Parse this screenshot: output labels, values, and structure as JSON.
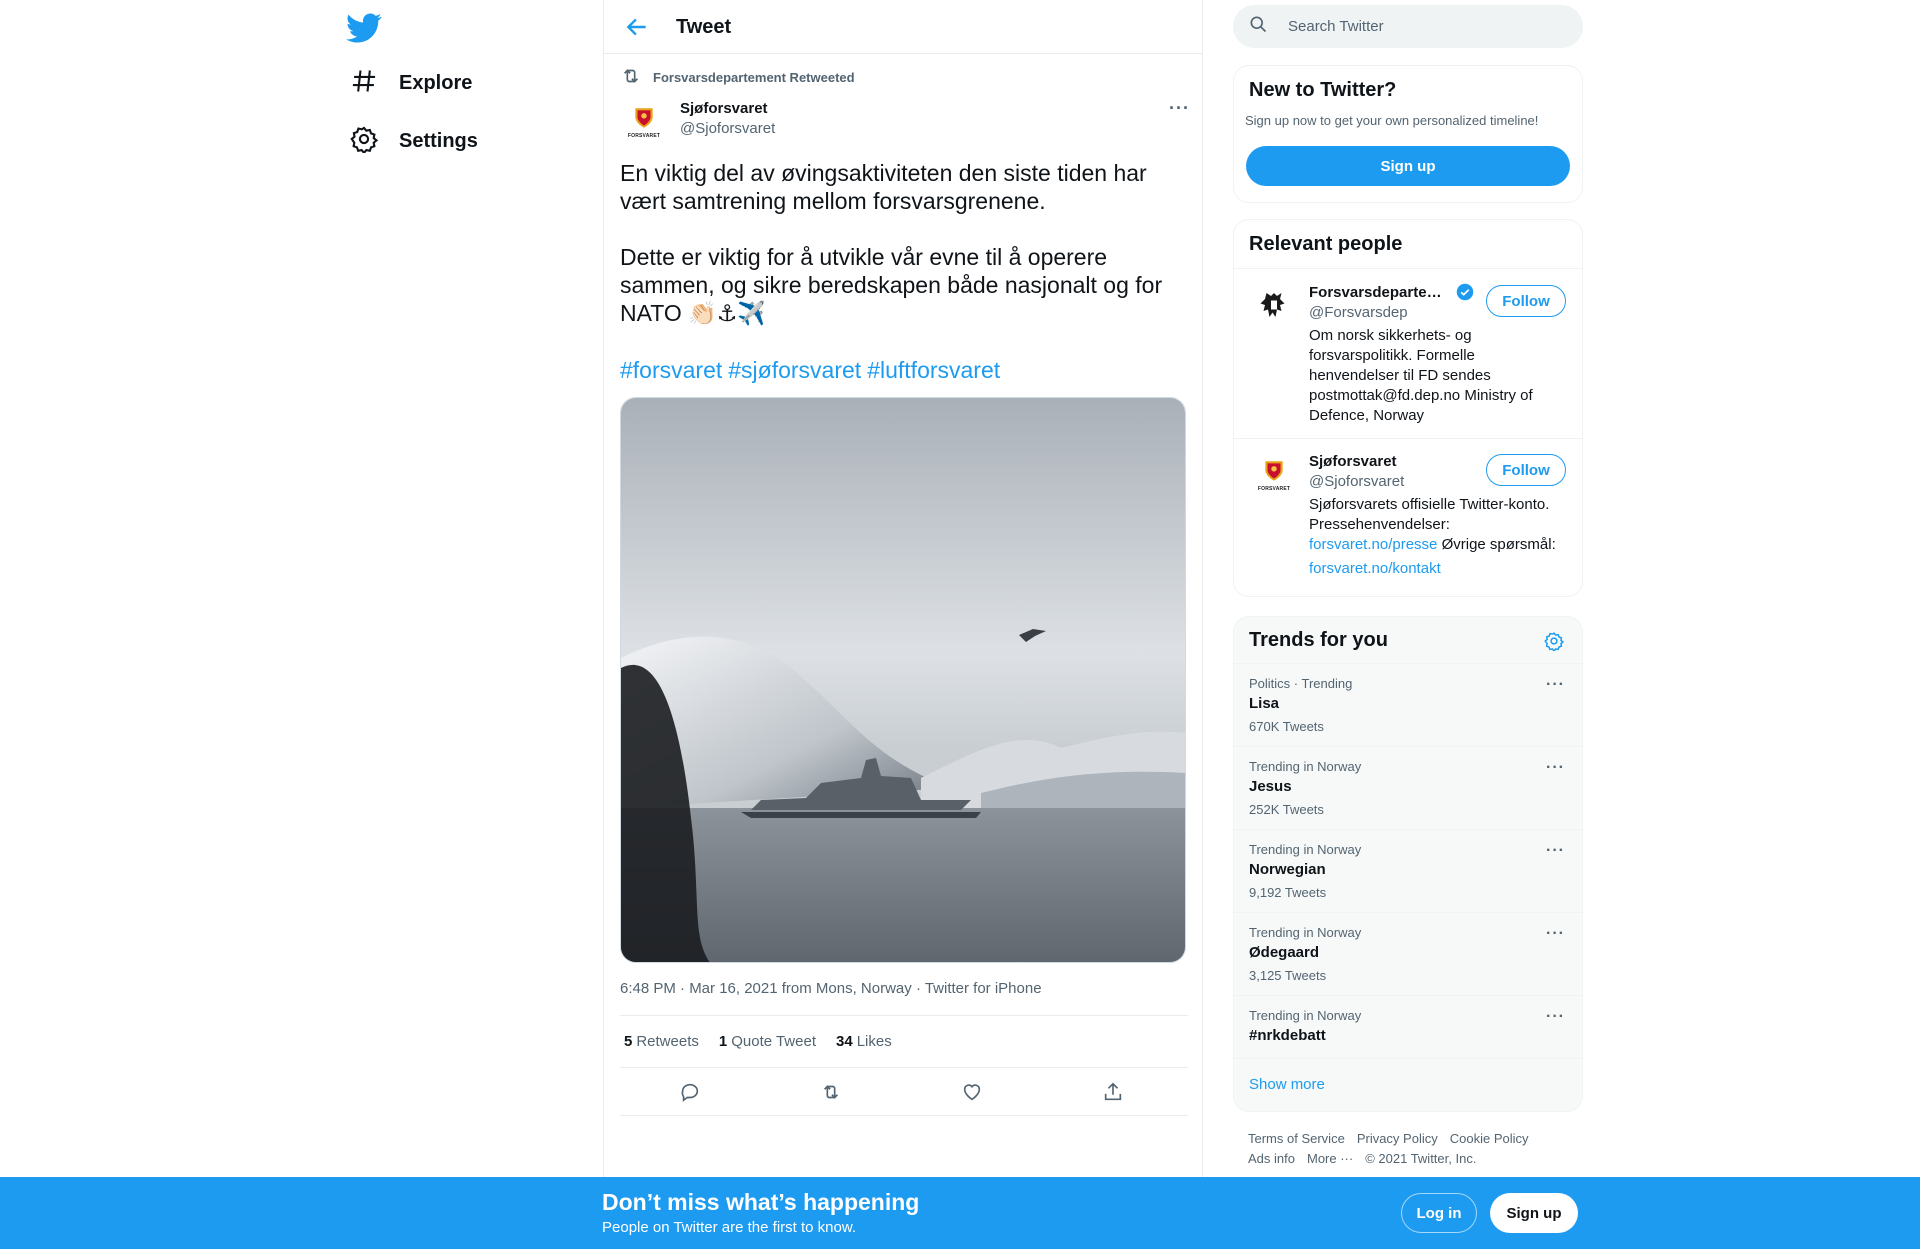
{
  "nav": {
    "logo": "twitter-bird-icon",
    "items": [
      {
        "label": "Explore",
        "icon": "hashtag-icon"
      },
      {
        "label": "Settings",
        "icon": "gear-icon"
      }
    ]
  },
  "header": {
    "title": "Tweet"
  },
  "tweet": {
    "retweeted_by": "Forsvarsdepartement Retweeted",
    "author_name": "Sjøforsvaret",
    "author_handle": "@Sjoforsvaret",
    "avatar_badge": "FORSVARET",
    "text": "En viktig del av øvingsaktiviteten den siste tiden har vært samtrening mellom forsvarsgrenene.\n\nDette er viktig for å utvikle vår evne til å operere sammen, og sikre beredskapen både nasjonalt og for NATO 👏🏻⚓✈️",
    "hashtags": [
      "#forsvaret",
      "#sjøforsvaret",
      "#luftforsvaret"
    ],
    "meta": "6:48 PM · Mar 16, 2021 from Mons, Norway · Twitter for iPhone",
    "stats": {
      "retweets_count": "5",
      "retweets_label": "Retweets",
      "quotes_count": "1",
      "quotes_label": "Quote Tweet",
      "likes_count": "34",
      "likes_label": "Likes"
    }
  },
  "search": {
    "placeholder": "Search Twitter"
  },
  "new_to_twitter": {
    "title": "New to Twitter?",
    "subtitle": "Sign up now to get your own personalized timeline!",
    "button": "Sign up"
  },
  "relevant_people": {
    "title": "Relevant people",
    "people": [
      {
        "name": "Forsvarsdepartement",
        "handle": "@Forsvarsdep",
        "verified": true,
        "bio": "Om norsk sikkerhets- og forsvarspolitikk. Formelle henvendelser til FD sendes postmottak@fd.dep.no Ministry of Defence, Norway",
        "follow": "Follow"
      },
      {
        "name": "Sjøforsvaret",
        "handle": "@Sjoforsvaret",
        "bio_prefix": "Sjøforsvarets offisielle Twitter-konto. Pressehenvendelser: ",
        "bio_link1": "forsvaret.no/presse",
        "bio_mid": " Øvrige spørsmål: ",
        "bio_link2": "forsvaret.no/kontakt",
        "follow": "Follow"
      }
    ]
  },
  "trends": {
    "title": "Trends for you",
    "items": [
      {
        "category": "Politics · Trending",
        "name": "Lisa",
        "count": "670K Tweets"
      },
      {
        "category": "Trending in Norway",
        "name": "Jesus",
        "count": "252K Tweets"
      },
      {
        "category": "Trending in Norway",
        "name": "Norwegian",
        "count": "9,192 Tweets"
      },
      {
        "category": "Trending in Norway",
        "name": "Ødegaard",
        "count": "3,125 Tweets"
      },
      {
        "category": "Trending in Norway",
        "name": "#nrkdebatt",
        "count": ""
      }
    ],
    "show_more": "Show more"
  },
  "footer": {
    "links": [
      "Terms of Service",
      "Privacy Policy",
      "Cookie Policy",
      "Ads info",
      "More ···"
    ],
    "copyright": "© 2021 Twitter, Inc."
  },
  "bottom_bar": {
    "title": "Don’t miss what’s happening",
    "subtitle": "People on Twitter are the first to know.",
    "login": "Log in",
    "signup": "Sign up"
  },
  "colors": {
    "accent": "#1d9bf0",
    "text": "#0f1419",
    "secondary": "#536471"
  }
}
